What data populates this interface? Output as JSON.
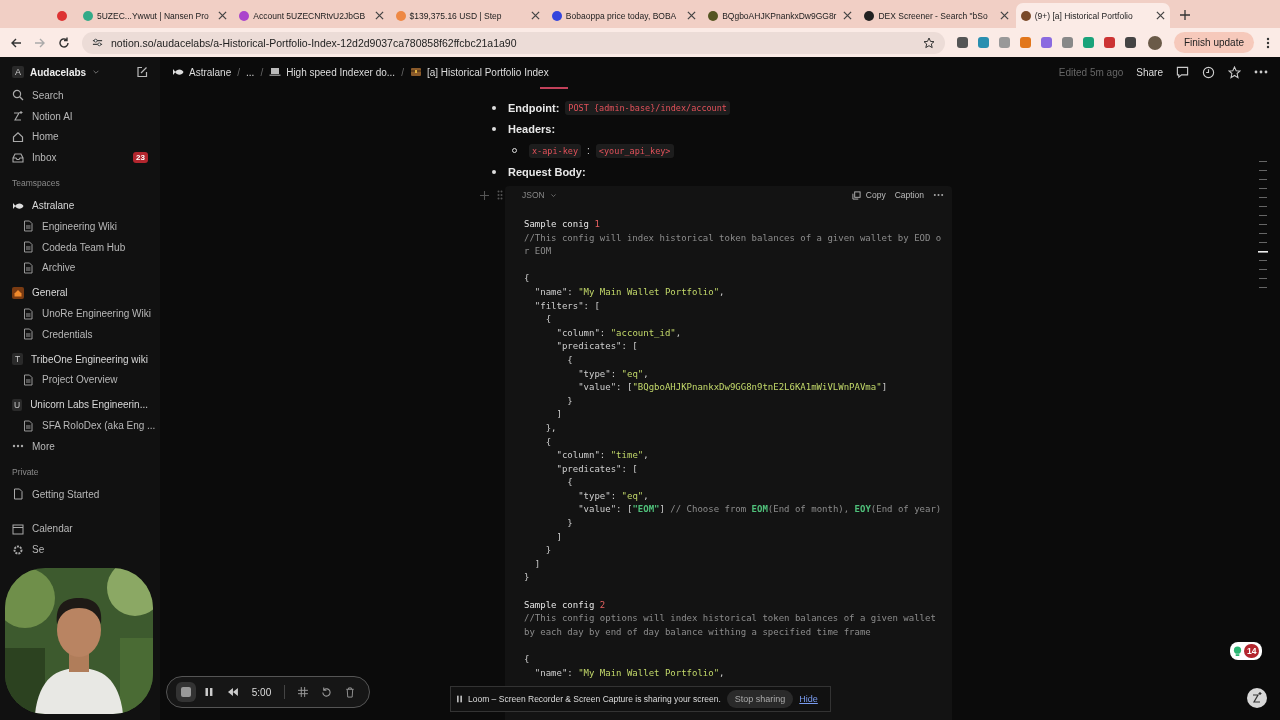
{
  "browser": {
    "tabs": [
      {
        "selected": false
      },
      {
        "title": "5UZEC...Ywwut | Nansen Pro",
        "selected": false
      },
      {
        "title": "Account 5UZECNRtvU2JbGB",
        "selected": false
      },
      {
        "title": "$139,375.16 USD | Step",
        "selected": false
      },
      {
        "title": "Bobaoppa price today, BOBA",
        "selected": false
      },
      {
        "title": "BQgboAHJKPnankxDw9GG8r",
        "selected": false
      },
      {
        "title": "DEX Screener - Search \"bSo",
        "selected": false
      },
      {
        "title": "(9+) [a] Historical Portfolio",
        "selected": true
      }
    ],
    "address": "notion.so/audacelabs/a-Historical-Portfolio-Index-12d2d9037ca780858f62ffcbc21a1a90",
    "update_button": "Finish update"
  },
  "sidebar": {
    "workspace": "Audacelabs",
    "workspace_initial": "A",
    "nav": [
      {
        "label": "Search"
      },
      {
        "label": "Notion AI"
      },
      {
        "label": "Home"
      },
      {
        "label": "Inbox",
        "badge": "23"
      }
    ],
    "sections": [
      {
        "title": "Teamspaces",
        "spaces": [
          {
            "name": "Astralane",
            "children": [
              {
                "name": "Engineering Wiki"
              },
              {
                "name": "Codeda Team Hub"
              },
              {
                "name": "Archive"
              }
            ]
          },
          {
            "name": "General",
            "children": [
              {
                "name": "UnoRe Engineering Wiki"
              },
              {
                "name": "Credentials"
              }
            ]
          },
          {
            "name": "TribeOne Engineering wiki",
            "initial": "T",
            "children": [
              {
                "name": "Project Overview"
              }
            ]
          },
          {
            "name": "Unicorn Labs Engineerin...",
            "initial": "U",
            "children": [
              {
                "name": "SFA RoloDex (aka Eng ..."
              }
            ]
          }
        ],
        "more": "More"
      },
      {
        "title": "Private",
        "spaces": [
          {
            "name": "Getting Started"
          }
        ]
      }
    ],
    "bottom": [
      {
        "label": "Calendar"
      },
      {
        "label": "Se"
      }
    ]
  },
  "header": {
    "breadcrumbs": [
      "Astralane",
      "...",
      "High speed Indexer do...",
      "[a] Historical Portfolio Index"
    ],
    "separator": "/",
    "edited": "Edited 5m ago",
    "share": "Share"
  },
  "content": {
    "bullets": [
      {
        "label": "Endpoint:",
        "code": "POST {admin-base}/index/account"
      },
      {
        "label": "Headers:",
        "children": [
          {
            "code_key": "x-api-key",
            "separator": ":",
            "code_value": "<your_api_key>"
          }
        ]
      },
      {
        "label": "Request Body:"
      }
    ],
    "code_block": {
      "language": "JSON",
      "copy": "Copy",
      "caption": "Caption",
      "lines": [
        [
          {
            "kind": "text",
            "text": "Sample conig "
          },
          {
            "kind": "number",
            "text": "1"
          }
        ],
        [
          {
            "kind": "comment",
            "text": "//This config will index historical token balances of a given wallet by EOD o"
          }
        ],
        [
          {
            "kind": "comment",
            "text": "r EOM"
          }
        ],
        [
          {
            "kind": "gap"
          },
          {
            "kind": "punct",
            "text": "{"
          }
        ],
        [
          {
            "kind": "punct",
            "text": "  \"name\": "
          },
          {
            "kind": "string",
            "text": "\"My Main Wallet Portfolio\""
          },
          {
            "kind": "punct",
            "text": ","
          }
        ],
        [
          {
            "kind": "punct",
            "text": "  \"filters\": ["
          }
        ],
        [
          {
            "kind": "punct",
            "text": "    {"
          }
        ],
        [
          {
            "kind": "punct",
            "text": "      \"column\": "
          },
          {
            "kind": "string",
            "text": "\"account_id\""
          },
          {
            "kind": "punct",
            "text": ","
          }
        ],
        [
          {
            "kind": "punct",
            "text": "      \"predicates\": ["
          }
        ],
        [
          {
            "kind": "punct",
            "text": "        {"
          }
        ],
        [
          {
            "kind": "punct",
            "text": "          \"type\": "
          },
          {
            "kind": "string",
            "text": "\"eq\""
          },
          {
            "kind": "punct",
            "text": ","
          }
        ],
        [
          {
            "kind": "punct",
            "text": "          \"value\": ["
          },
          {
            "kind": "string",
            "text": "\"BQgboAHJKPnankxDw9GG8n9tnE2L6KA1mWiVLWnPAVma\""
          },
          {
            "kind": "punct",
            "text": "]"
          }
        ],
        [
          {
            "kind": "punct",
            "text": "        }"
          }
        ],
        [
          {
            "kind": "punct",
            "text": "      ]"
          }
        ],
        [
          {
            "kind": "punct",
            "text": "    },"
          }
        ],
        [
          {
            "kind": "punct",
            "text": "    {"
          }
        ],
        [
          {
            "kind": "punct",
            "text": "      \"column\": "
          },
          {
            "kind": "string",
            "text": "\"time\""
          },
          {
            "kind": "punct",
            "text": ","
          }
        ],
        [
          {
            "kind": "punct",
            "text": "      \"predicates\": ["
          }
        ],
        [
          {
            "kind": "punct",
            "text": "        {"
          }
        ],
        [
          {
            "kind": "punct",
            "text": "          \"type\": "
          },
          {
            "kind": "string",
            "text": "\"eq\""
          },
          {
            "kind": "punct",
            "text": ","
          }
        ],
        [
          {
            "kind": "punct",
            "text": "          \"value\": ["
          },
          {
            "kind": "highlight",
            "text": "\"EOM\""
          },
          {
            "kind": "punct",
            "text": "] "
          },
          {
            "kind": "comment",
            "text": "// Choose from "
          },
          {
            "kind": "highlight",
            "text": "EOM"
          },
          {
            "kind": "comment",
            "text": "(End of month), "
          },
          {
            "kind": "highlight",
            "text": "EOY"
          },
          {
            "kind": "comment",
            "text": "(End of year)"
          }
        ],
        [
          {
            "kind": "punct",
            "text": "        }"
          }
        ],
        [
          {
            "kind": "punct",
            "text": "      ]"
          }
        ],
        [
          {
            "kind": "punct",
            "text": "    }"
          }
        ],
        [
          {
            "kind": "punct",
            "text": "  ]"
          }
        ],
        [
          {
            "kind": "punct",
            "text": "}"
          }
        ],
        [
          {
            "kind": "gap"
          },
          {
            "kind": "text",
            "text": "Sample config "
          },
          {
            "kind": "number",
            "text": "2"
          }
        ],
        [
          {
            "kind": "comment",
            "text": "//This config options will index historical token balances of a given wallet"
          }
        ],
        [
          {
            "kind": "comment",
            "text": "by each day by end of day balance withing a specified time frame"
          }
        ],
        [
          {
            "kind": "gap"
          },
          {
            "kind": "punct",
            "text": "{"
          }
        ],
        [
          {
            "kind": "punct",
            "text": "  \"name\": "
          },
          {
            "kind": "string",
            "text": "\"My Main Wallet Portfolio\""
          },
          {
            "kind": "punct",
            "text": ","
          }
        ]
      ]
    }
  },
  "help_badge": "14",
  "recorder": {
    "time": "5:00"
  },
  "share_notice": {
    "message": "Loom – Screen Recorder & Screen Capture is sharing your screen.",
    "stop": "Stop sharing",
    "hide": "Hide"
  }
}
